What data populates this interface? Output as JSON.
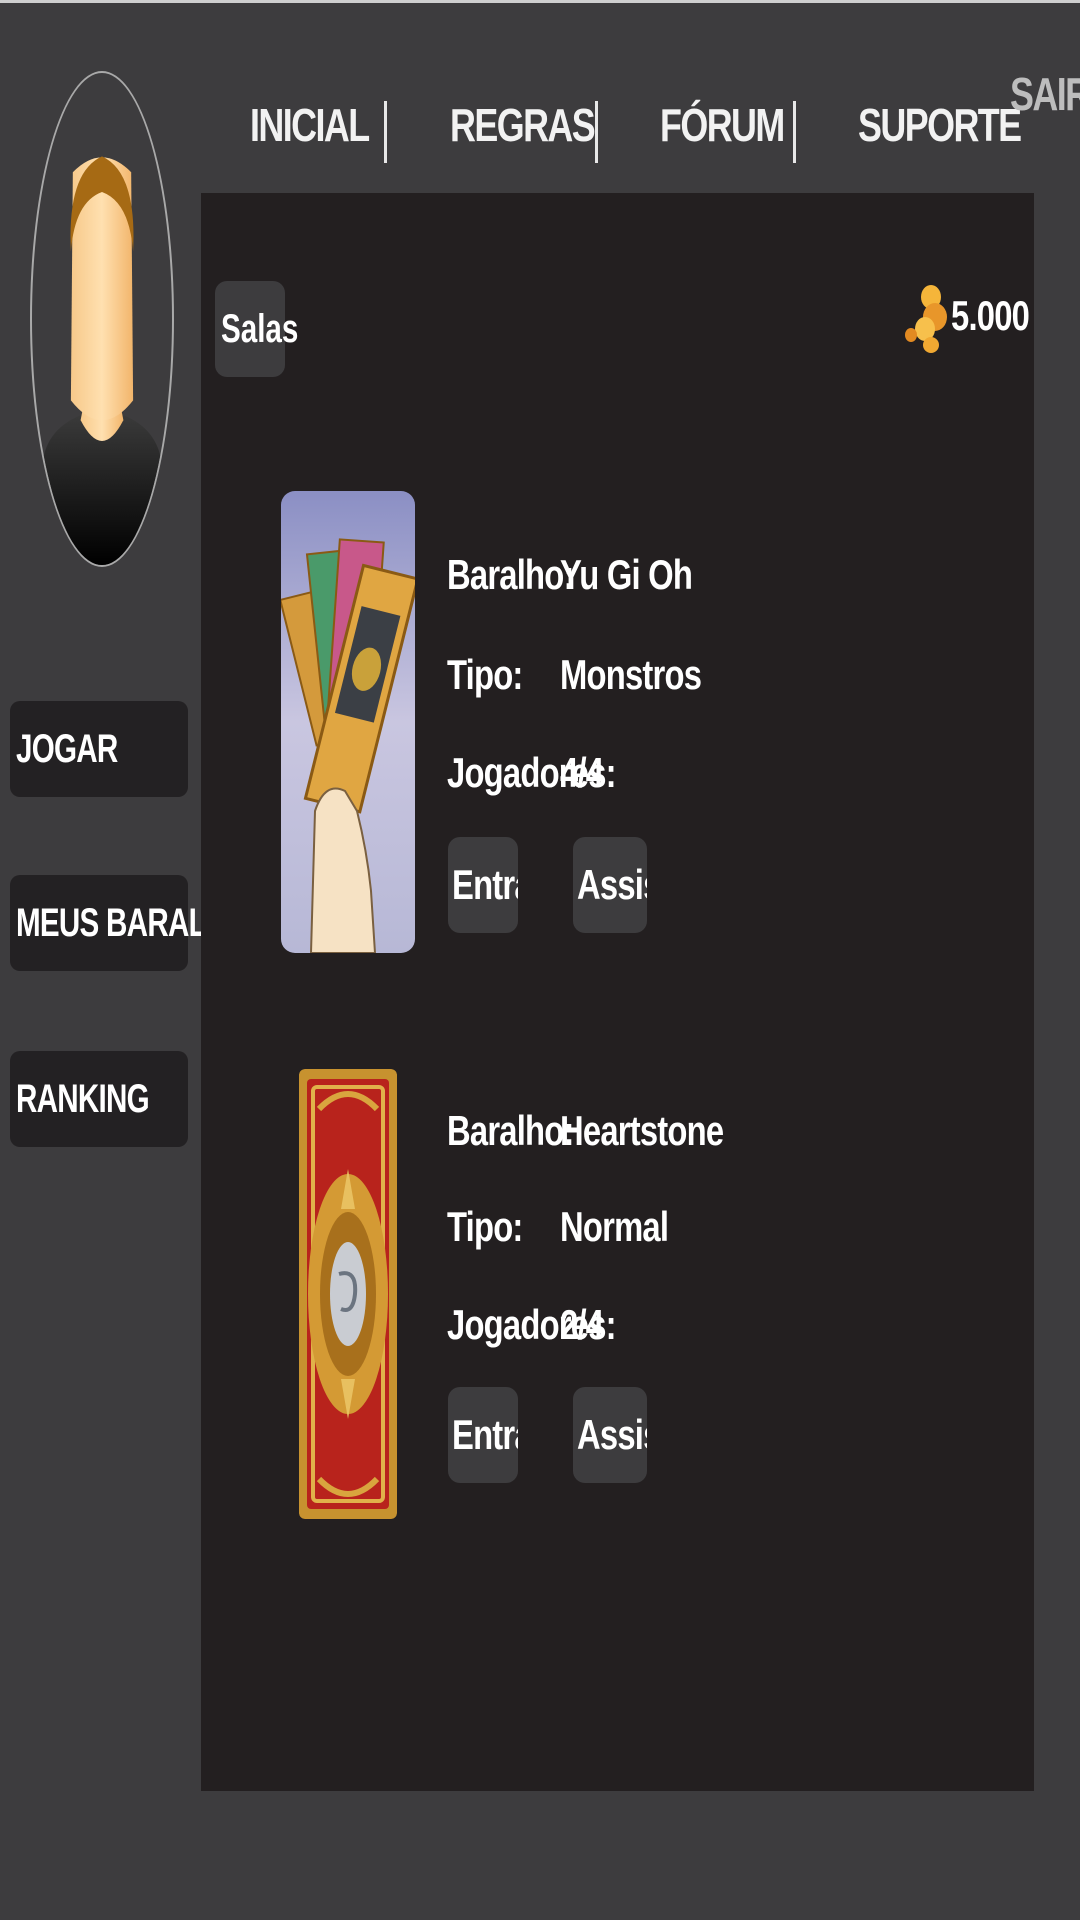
{
  "nav": {
    "items": [
      "INICIAL",
      "REGRAS",
      "FÓRUM",
      "SUPORTE"
    ],
    "logout_label": "SAIR"
  },
  "sidebar": {
    "items": [
      {
        "label": "JOGAR"
      },
      {
        "label": "MEUS BARALHOS"
      },
      {
        "label": "RANKING"
      }
    ]
  },
  "main": {
    "section_title": "Salas",
    "coins": "5.000",
    "rooms": [
      {
        "image_icon": "yugioh-cards-image",
        "deck_label": "Baralho:",
        "deck_value": "Yu Gi Oh",
        "type_label": "Tipo:",
        "type_value": "Monstros",
        "players_label": "Jogadores:",
        "players_value": "4/4",
        "enter_label": "Entrar",
        "watch_label": "Assistir"
      },
      {
        "image_icon": "hearthstone-card-back-image",
        "deck_label": "Baralho:",
        "deck_value": "Heartstone",
        "type_label": "Tipo:",
        "type_value": "Normal",
        "players_label": "Jogadores:",
        "players_value": "2/4",
        "enter_label": "Entrar",
        "watch_label": "Assistir"
      }
    ]
  },
  "colors": {
    "background": "#3d3c3e",
    "panel": "#231f20",
    "button": "#3d3c3e",
    "text": "#ffffff",
    "coin": "#f2a42a"
  }
}
